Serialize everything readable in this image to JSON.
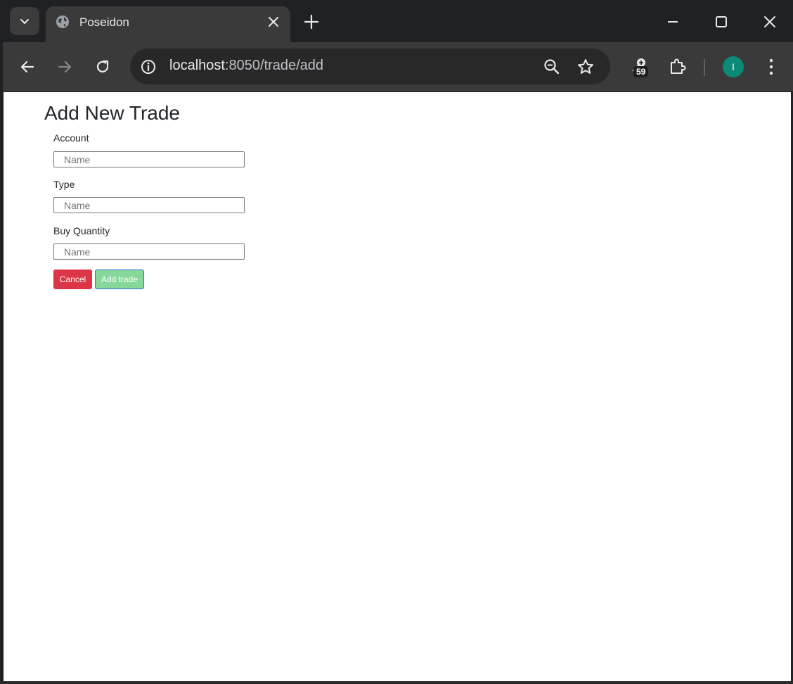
{
  "browser": {
    "tab": {
      "title": "Poseidon"
    },
    "omnibox": {
      "host": "localhost",
      "path": ":8050/trade/add"
    },
    "extension_badge": "59",
    "profile_initial": "I"
  },
  "page": {
    "title": "Add New Trade",
    "fields": [
      {
        "label": "Account",
        "placeholder": "Name",
        "value": ""
      },
      {
        "label": "Type",
        "placeholder": "Name",
        "value": ""
      },
      {
        "label": "Buy Quantity",
        "placeholder": "Name",
        "value": ""
      }
    ],
    "buttons": {
      "cancel_label": "Cancel",
      "add_label": "Add trade"
    }
  },
  "colors": {
    "cancel": "#dc3545",
    "add": "#86d79a",
    "avatar": "#0b8a78"
  }
}
